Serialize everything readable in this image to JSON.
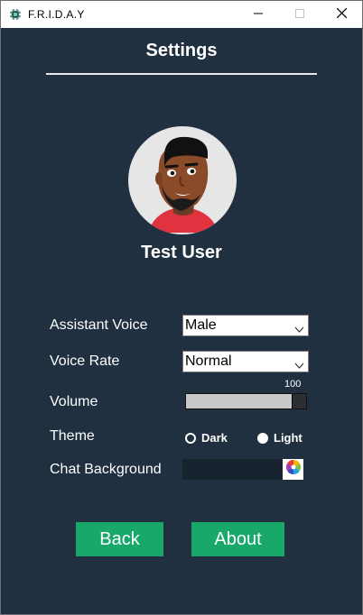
{
  "window": {
    "title": "F.R.I.D.A.Y",
    "app_icon": "chip-icon"
  },
  "page": {
    "heading": "Settings"
  },
  "profile": {
    "username": "Test User",
    "avatar": "user-avatar"
  },
  "settings": {
    "assistant_voice": {
      "label": "Assistant Voice",
      "value": "Male"
    },
    "voice_rate": {
      "label": "Voice Rate",
      "value": "Normal"
    },
    "volume": {
      "label": "Volume",
      "value": "100",
      "level": 1.0
    },
    "theme": {
      "label": "Theme",
      "options": [
        {
          "label": "Dark",
          "selected": true
        },
        {
          "label": "Light",
          "selected": false
        }
      ]
    },
    "chat_background": {
      "label": "Chat Background",
      "color": "#17232e",
      "picker_icon": "color-wheel-icon"
    }
  },
  "buttons": {
    "back": "Back",
    "about": "About"
  },
  "colors": {
    "background": "#203040",
    "accent": "#18a86a",
    "text": "#ffffff"
  }
}
